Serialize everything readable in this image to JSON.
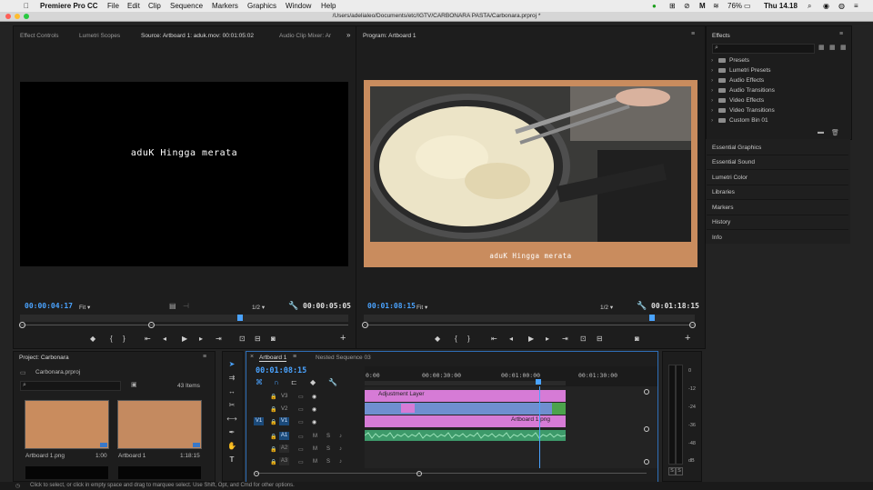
{
  "menubar": {
    "app": "Premiere Pro CC",
    "items": [
      "File",
      "Edit",
      "Clip",
      "Sequence",
      "Markers",
      "Graphics",
      "Window",
      "Help"
    ],
    "battery": "76%",
    "clock": "Thu 14.18"
  },
  "window": {
    "path": "/Users/adelialeo/Documents/etc/IGTV/CARBONARA PASTA/Carbonara.prproj *"
  },
  "source_panel": {
    "tabs": [
      "Effect Controls",
      "Lumetri Scopes",
      "Source: Artboard 1: aduk.mov: 00:01:05:02",
      "Audio Clip Mixer: Ar"
    ],
    "caption": "aduK Hingga merata",
    "timecode_in": "00:00:04:17",
    "fit": "Fit",
    "scale": "1/2",
    "timecode_out": "00:00:05:05"
  },
  "program_panel": {
    "tab": "Program: Artboard 1",
    "caption": "aduK Hingga merata",
    "timecode_in": "00:01:08:15",
    "fit": "Fit",
    "scale": "1/2",
    "timecode_out": "00:01:18:15"
  },
  "effects_panel": {
    "title": "Effects",
    "tree": [
      "Presets",
      "Lumetri Presets",
      "Audio Effects",
      "Audio Transitions",
      "Video Effects",
      "Video Transitions",
      "Custom Bin 01"
    ],
    "side_panels": [
      "Essential Graphics",
      "Essential Sound",
      "Lumetri Color",
      "Libraries",
      "Markers",
      "History",
      "Info"
    ]
  },
  "project_panel": {
    "title": "Project: Carbonara",
    "file": "Carbonara.prproj",
    "count": "43 Items",
    "items": [
      {
        "name": "Artboard 1.png",
        "duration": "1:00"
      },
      {
        "name": "Artboard 1",
        "duration": "1:18:15"
      }
    ]
  },
  "timeline": {
    "tabs": [
      "Artboard 1",
      "Nested Sequence 03"
    ],
    "timecode": "00:01:08:15",
    "ruler": [
      "0:00",
      "00:00:30:00",
      "00:01:00:00",
      "00:01:30:00"
    ],
    "video_tracks": [
      "V3",
      "V2",
      "V1"
    ],
    "audio_tracks": [
      "A1",
      "A2",
      "A3"
    ],
    "source_patch_v": "V1",
    "clips": {
      "adjustment": "Adjustment Layer",
      "artboard": "Artboard 1.png"
    },
    "meter_scale": [
      "0",
      "-12",
      "-24",
      "-36",
      "-48",
      "dB"
    ],
    "track_m": "M",
    "track_s": "S"
  },
  "statusbar": "Click to select, or click in empty space and drag to marquee select. Use Shift, Opt, and Cmd for other options.",
  "colors": {
    "accent": "#4aa3ff",
    "program_bg": "#c98c5e",
    "adjustment": "#d67bd6",
    "video_clip": "#6f8fd0",
    "audio_clip": "#3d9a6a"
  }
}
